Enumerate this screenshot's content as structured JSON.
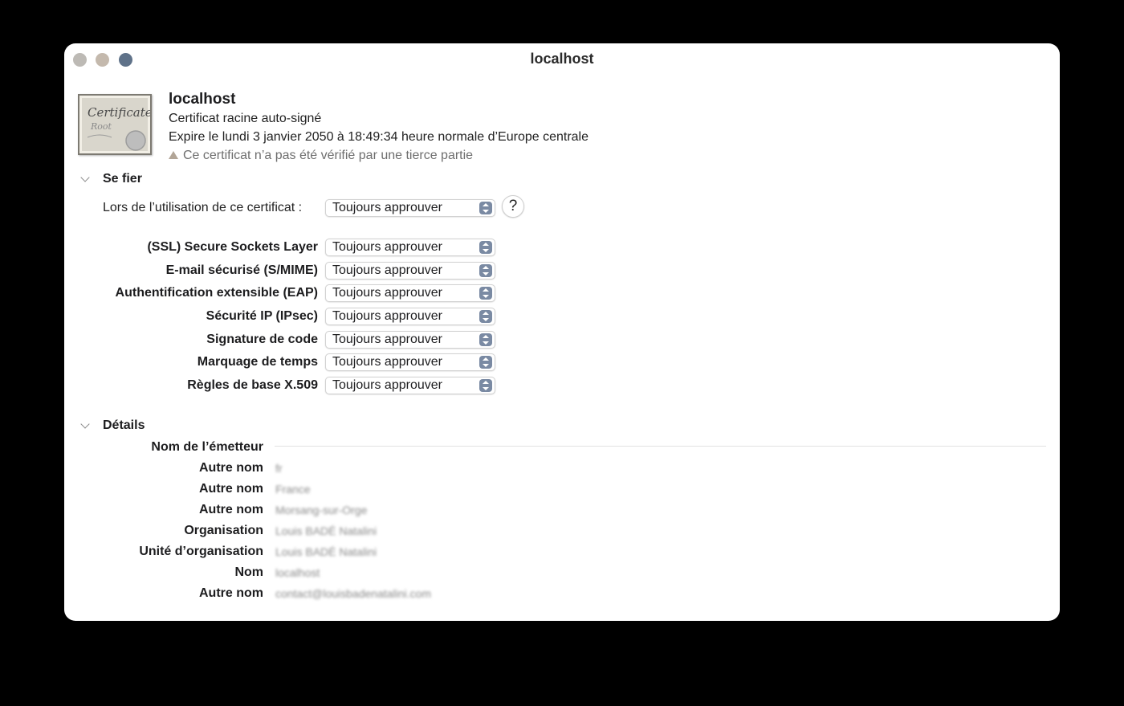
{
  "window": {
    "title": "localhost"
  },
  "certificate": {
    "icon": "certificate-root-icon",
    "icon_text_1": "Certificate",
    "icon_text_2": "Root",
    "name": "localhost",
    "type": "Certificat racine auto-signé",
    "expires": "Expire le lundi 3 janvier 2050 à 18:49:34 heure normale d’Europe centrale",
    "warning": "Ce certificat n’a pas été vérifié par une tierce partie"
  },
  "trust": {
    "heading": "Se fier",
    "usage_label": "Lors de l’utilisation de ce certificat :",
    "usage_value": "Toujours approuver",
    "help_label": "?",
    "rows": [
      {
        "label": "(SSL) Secure Sockets Layer",
        "value": "Toujours approuver"
      },
      {
        "label": "E-mail sécurisé (S/MIME)",
        "value": "Toujours approuver"
      },
      {
        "label": "Authentification extensible (EAP)",
        "value": "Toujours approuver"
      },
      {
        "label": "Sécurité IP (IPsec)",
        "value": "Toujours approuver"
      },
      {
        "label": "Signature de code",
        "value": "Toujours approuver"
      },
      {
        "label": "Marquage de temps",
        "value": "Toujours approuver"
      },
      {
        "label": "Règles de base X.509",
        "value": "Toujours approuver"
      }
    ]
  },
  "details": {
    "heading": "Détails",
    "issuer_heading": "Nom de l’émetteur",
    "rows": [
      {
        "label": "Autre nom",
        "value": "fr"
      },
      {
        "label": "Autre nom",
        "value": "France"
      },
      {
        "label": "Autre nom",
        "value": "Morsang-sur-Orge"
      },
      {
        "label": "Organisation",
        "value": "Louis BADÉ Natalini"
      },
      {
        "label": "Unité d’organisation",
        "value": "Louis BADÉ Natalini"
      },
      {
        "label": "Nom",
        "value": "localhost"
      },
      {
        "label": "Autre nom",
        "value": "contact@louisbadenatalini.com"
      }
    ]
  }
}
